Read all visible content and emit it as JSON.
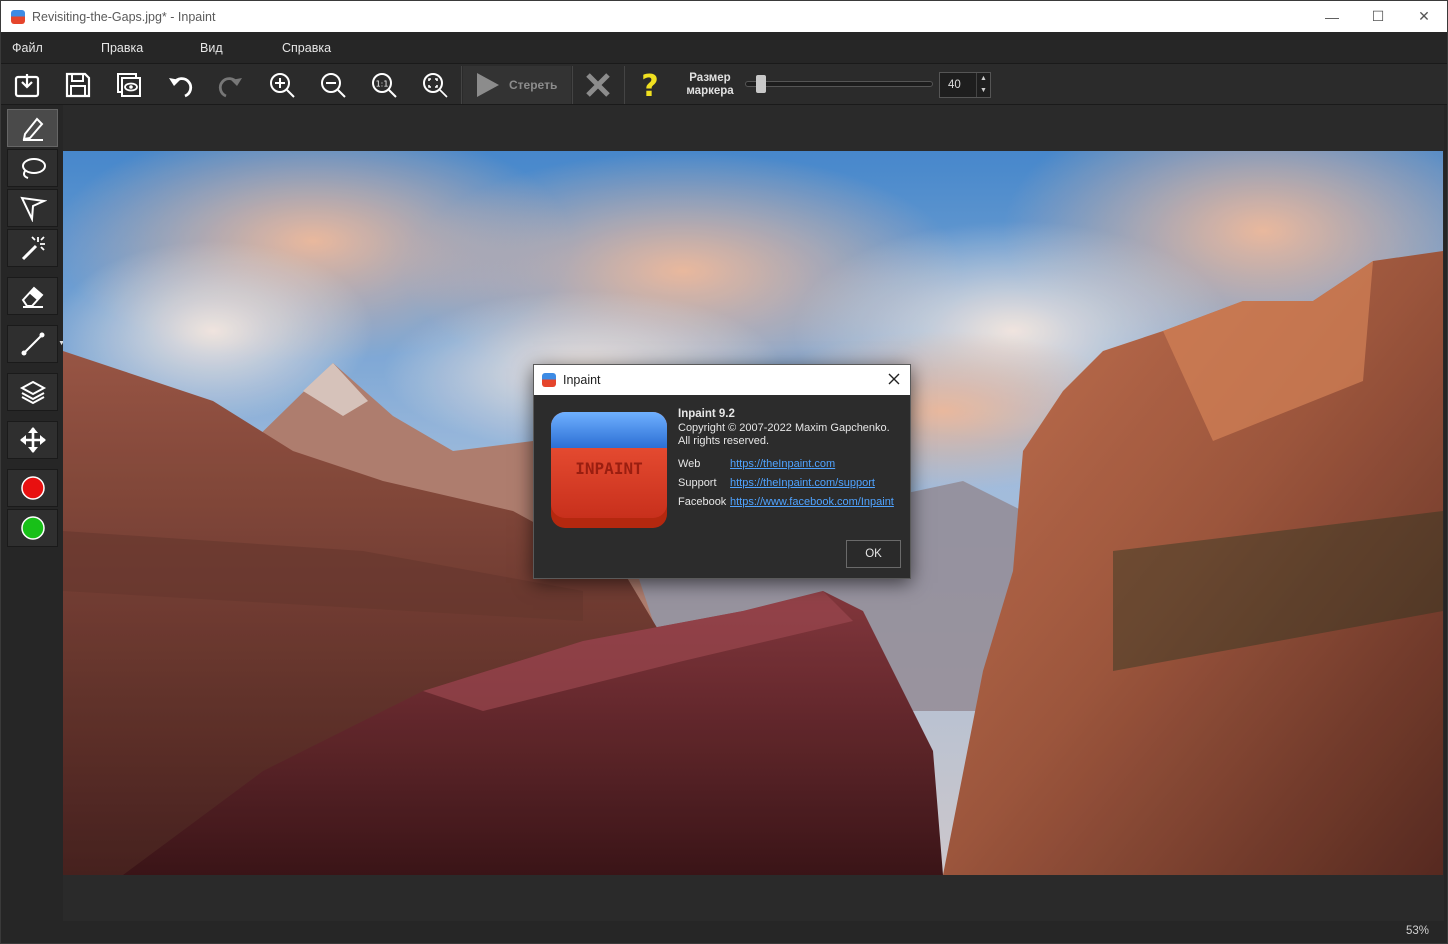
{
  "window": {
    "title": "Revisiting-the-Gaps.jpg* - Inpaint",
    "minimize": "—",
    "maximize": "☐",
    "close": "✕"
  },
  "menu": [
    {
      "label": "Файл"
    },
    {
      "label": "Правка"
    },
    {
      "label": "Вид"
    },
    {
      "label": "Справка"
    }
  ],
  "toolbar": {
    "erase_label": "Стереть",
    "marker_label_line1": "Размер",
    "marker_label_line2": "маркера",
    "marker_size": "40",
    "marker_fraction": 0.06,
    "icons": [
      "open-icon",
      "save-icon",
      "preview-icon",
      "undo-icon",
      "redo-icon",
      "zoom-in-icon",
      "zoom-out-icon",
      "actual-size-icon",
      "fit-icon",
      "play-icon",
      "cancel-icon",
      "help-icon"
    ]
  },
  "tools": [
    "marker-icon",
    "lasso-icon",
    "polygon-lasso-icon",
    "magic-wand-icon",
    "eraser-icon",
    "line-icon",
    "layers-icon",
    "move-icon"
  ],
  "colors": {
    "red": "#e81010",
    "green": "#18c018"
  },
  "status": {
    "zoom": "53%"
  },
  "dialog": {
    "title": "Inpaint",
    "logo_text": "INPAINT",
    "product": "Inpaint 9.2",
    "copyright": "Copyright © 2007-2022 Maxim Gapchenko.",
    "rights": "All rights reserved.",
    "rows": [
      {
        "label": "Web",
        "url": "https://theInpaint.com"
      },
      {
        "label": "Support",
        "url": "https://theInpaint.com/support"
      },
      {
        "label": "Facebook",
        "url": "https://www.facebook.com/Inpaint"
      }
    ],
    "ok_label": "OK"
  }
}
